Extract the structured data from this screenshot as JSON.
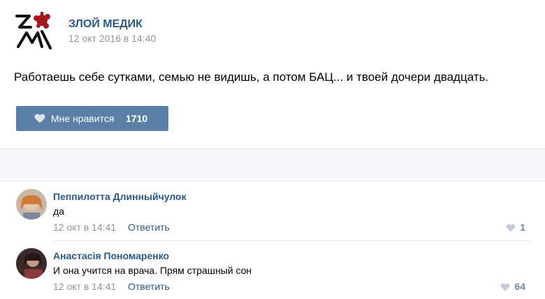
{
  "post": {
    "author": "ЗЛОЙ МЕДИК",
    "date": "12 окт 2016 в 14:40",
    "text": "Работаешь себе сутками, семью не видишь, а потом БАЦ... и твоей дочери двадцать.",
    "like_label": "Мне нравится",
    "like_count": "1710"
  },
  "colors": {
    "link": "#2a5885",
    "like_button": "#5b7fa6",
    "meta_gray": "#939393",
    "logo_red": "#a5161d"
  },
  "comments": [
    {
      "author": "Пеппилотта Длинныйчулок",
      "text": "да",
      "date": "12 окт в 14:41",
      "reply_label": "Ответить",
      "likes": "1"
    },
    {
      "author": "Анастасія Пономаренко",
      "text": "И она учится на врача. Прям страшный сон",
      "date": "12 окт в 14:41",
      "reply_label": "Ответить",
      "likes": "64"
    }
  ]
}
